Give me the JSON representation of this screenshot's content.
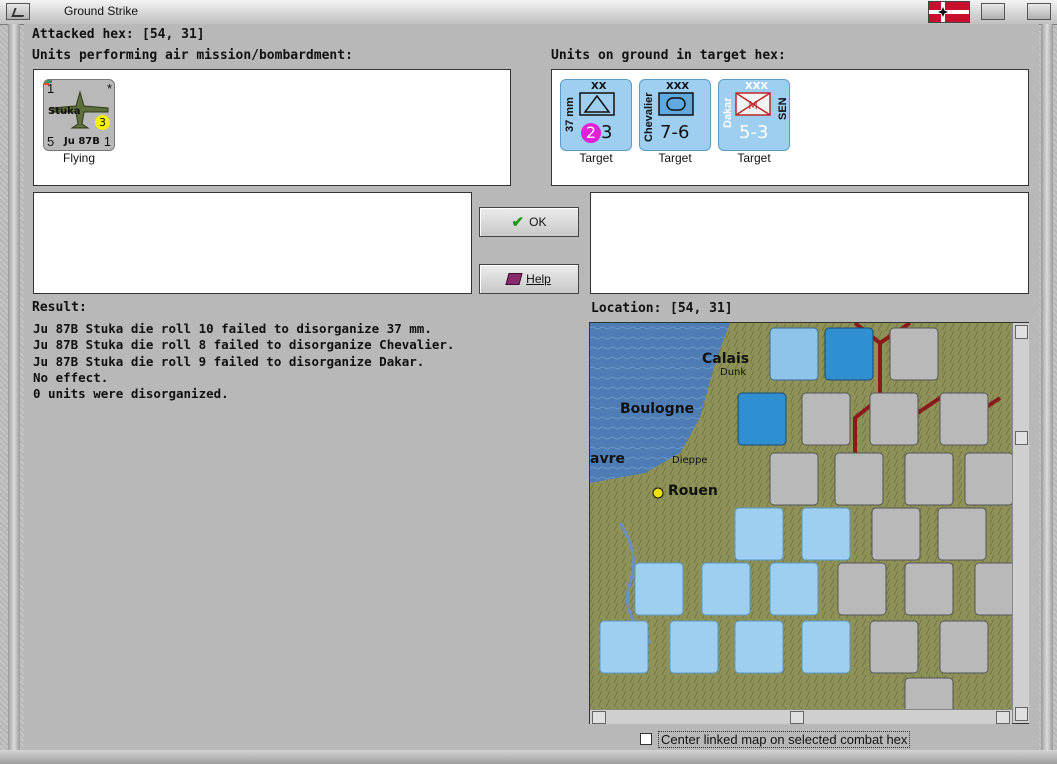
{
  "window": {
    "title": "Ground Strike"
  },
  "header": {
    "attacked_hex_label": "Attacked hex:",
    "attacked_hex_value": "[54, 31]"
  },
  "air_panel": {
    "label": "Units performing air mission/bombardment:",
    "unit": {
      "name": "Stuka",
      "type": "Ju 87B",
      "top_left": "1",
      "top_right": "*",
      "bottom_left": "5",
      "bottom_right": "1",
      "badge": "3",
      "caption": "Flying"
    }
  },
  "ground_panel": {
    "label": "Units on ground in target hex:",
    "units": [
      {
        "size": "XX",
        "side_label": "37 mm",
        "strength": "3",
        "circle": "2",
        "caption": "Target"
      },
      {
        "size": "XXX",
        "side_label": "Chevalier",
        "strength": "7-6",
        "caption": "Target"
      },
      {
        "size": "XXX",
        "side_label": "Dakar",
        "right_label": "SEN",
        "strength": "5-3",
        "caption": "Target"
      }
    ]
  },
  "buttons": {
    "ok": "OK",
    "help": "Help"
  },
  "result": {
    "label": "Result:",
    "lines": [
      "Ju 87B Stuka die roll 10 failed to disorganize 37 mm.",
      "Ju 87B Stuka die roll 8 failed to disorganize Chevalier.",
      "Ju 87B Stuka die roll 9 failed to disorganize Dakar.",
      "No effect.",
      "0 units were disorganized."
    ]
  },
  "location": {
    "label": "Location:",
    "value": "[54, 31]"
  },
  "map": {
    "places": [
      "Calais",
      "Boulogne",
      "Rouen",
      "Dieppe",
      "Dunk",
      "avre"
    ]
  },
  "checkbox": {
    "label": "Center linked map on selected combat hex",
    "checked": false
  },
  "colors": {
    "unit_blue": "#9ecff0",
    "unit_grey": "#b9b9b9",
    "map_land": "#8c8f58",
    "sea": "#4f7fb8",
    "border_red": "#8b1a1a"
  }
}
